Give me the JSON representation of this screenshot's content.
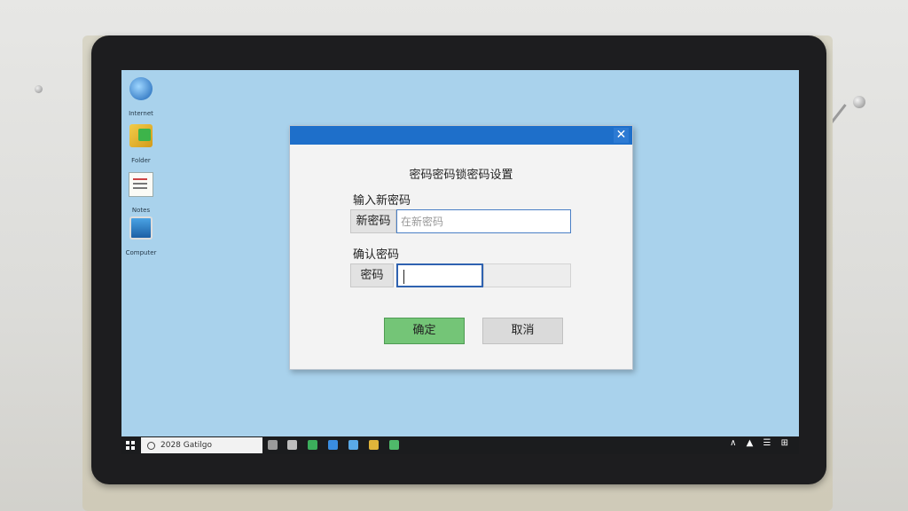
{
  "desktop": {
    "icons": [
      {
        "caption": "Internet",
        "icon": "globe-icon"
      },
      {
        "caption": "Folder",
        "icon": "folder-icon"
      },
      {
        "caption": "Notes",
        "icon": "document-icon"
      },
      {
        "caption": "Computer",
        "icon": "computer-icon"
      }
    ]
  },
  "dialog": {
    "title": "密码密码锁密码设置",
    "close_glyph": "✕",
    "new_section_label": "输入新密码",
    "new_prefix": "新密码",
    "new_placeholder": "在新密码",
    "confirm_section_label": "确认密码",
    "confirm_prefix": "密码",
    "confirm_value": "",
    "ok_label": "确定",
    "cancel_label": "取消"
  },
  "taskbar": {
    "search_text": "2028 Gatilgo",
    "tray_text": "∧ ▲ ☰ ⊞",
    "icon_colors": [
      "#9a9a9a",
      "#bdbdbd",
      "#3cae5c",
      "#3a8de0",
      "#5aa9e6",
      "#e0b43a",
      "#4fb96a"
    ]
  },
  "colors": {
    "titlebar": "#1e6fca",
    "ok_button": "#74c577",
    "desktop": "#a9d2ec"
  }
}
